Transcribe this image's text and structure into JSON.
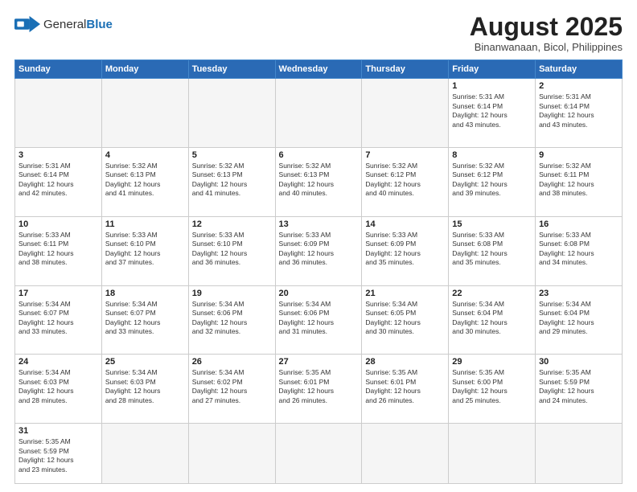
{
  "logo": {
    "text_general": "General",
    "text_blue": "Blue"
  },
  "header": {
    "month": "August 2025",
    "location": "Binanwanaan, Bicol, Philippines"
  },
  "days_of_week": [
    "Sunday",
    "Monday",
    "Tuesday",
    "Wednesday",
    "Thursday",
    "Friday",
    "Saturday"
  ],
  "weeks": [
    [
      {
        "day": "",
        "info": ""
      },
      {
        "day": "",
        "info": ""
      },
      {
        "day": "",
        "info": ""
      },
      {
        "day": "",
        "info": ""
      },
      {
        "day": "",
        "info": ""
      },
      {
        "day": "1",
        "info": "Sunrise: 5:31 AM\nSunset: 6:14 PM\nDaylight: 12 hours\nand 43 minutes."
      },
      {
        "day": "2",
        "info": "Sunrise: 5:31 AM\nSunset: 6:14 PM\nDaylight: 12 hours\nand 43 minutes."
      }
    ],
    [
      {
        "day": "3",
        "info": "Sunrise: 5:31 AM\nSunset: 6:14 PM\nDaylight: 12 hours\nand 42 minutes."
      },
      {
        "day": "4",
        "info": "Sunrise: 5:32 AM\nSunset: 6:13 PM\nDaylight: 12 hours\nand 41 minutes."
      },
      {
        "day": "5",
        "info": "Sunrise: 5:32 AM\nSunset: 6:13 PM\nDaylight: 12 hours\nand 41 minutes."
      },
      {
        "day": "6",
        "info": "Sunrise: 5:32 AM\nSunset: 6:13 PM\nDaylight: 12 hours\nand 40 minutes."
      },
      {
        "day": "7",
        "info": "Sunrise: 5:32 AM\nSunset: 6:12 PM\nDaylight: 12 hours\nand 40 minutes."
      },
      {
        "day": "8",
        "info": "Sunrise: 5:32 AM\nSunset: 6:12 PM\nDaylight: 12 hours\nand 39 minutes."
      },
      {
        "day": "9",
        "info": "Sunrise: 5:32 AM\nSunset: 6:11 PM\nDaylight: 12 hours\nand 38 minutes."
      }
    ],
    [
      {
        "day": "10",
        "info": "Sunrise: 5:33 AM\nSunset: 6:11 PM\nDaylight: 12 hours\nand 38 minutes."
      },
      {
        "day": "11",
        "info": "Sunrise: 5:33 AM\nSunset: 6:10 PM\nDaylight: 12 hours\nand 37 minutes."
      },
      {
        "day": "12",
        "info": "Sunrise: 5:33 AM\nSunset: 6:10 PM\nDaylight: 12 hours\nand 36 minutes."
      },
      {
        "day": "13",
        "info": "Sunrise: 5:33 AM\nSunset: 6:09 PM\nDaylight: 12 hours\nand 36 minutes."
      },
      {
        "day": "14",
        "info": "Sunrise: 5:33 AM\nSunset: 6:09 PM\nDaylight: 12 hours\nand 35 minutes."
      },
      {
        "day": "15",
        "info": "Sunrise: 5:33 AM\nSunset: 6:08 PM\nDaylight: 12 hours\nand 35 minutes."
      },
      {
        "day": "16",
        "info": "Sunrise: 5:33 AM\nSunset: 6:08 PM\nDaylight: 12 hours\nand 34 minutes."
      }
    ],
    [
      {
        "day": "17",
        "info": "Sunrise: 5:34 AM\nSunset: 6:07 PM\nDaylight: 12 hours\nand 33 minutes."
      },
      {
        "day": "18",
        "info": "Sunrise: 5:34 AM\nSunset: 6:07 PM\nDaylight: 12 hours\nand 33 minutes."
      },
      {
        "day": "19",
        "info": "Sunrise: 5:34 AM\nSunset: 6:06 PM\nDaylight: 12 hours\nand 32 minutes."
      },
      {
        "day": "20",
        "info": "Sunrise: 5:34 AM\nSunset: 6:06 PM\nDaylight: 12 hours\nand 31 minutes."
      },
      {
        "day": "21",
        "info": "Sunrise: 5:34 AM\nSunset: 6:05 PM\nDaylight: 12 hours\nand 30 minutes."
      },
      {
        "day": "22",
        "info": "Sunrise: 5:34 AM\nSunset: 6:04 PM\nDaylight: 12 hours\nand 30 minutes."
      },
      {
        "day": "23",
        "info": "Sunrise: 5:34 AM\nSunset: 6:04 PM\nDaylight: 12 hours\nand 29 minutes."
      }
    ],
    [
      {
        "day": "24",
        "info": "Sunrise: 5:34 AM\nSunset: 6:03 PM\nDaylight: 12 hours\nand 28 minutes."
      },
      {
        "day": "25",
        "info": "Sunrise: 5:34 AM\nSunset: 6:03 PM\nDaylight: 12 hours\nand 28 minutes."
      },
      {
        "day": "26",
        "info": "Sunrise: 5:34 AM\nSunset: 6:02 PM\nDaylight: 12 hours\nand 27 minutes."
      },
      {
        "day": "27",
        "info": "Sunrise: 5:35 AM\nSunset: 6:01 PM\nDaylight: 12 hours\nand 26 minutes."
      },
      {
        "day": "28",
        "info": "Sunrise: 5:35 AM\nSunset: 6:01 PM\nDaylight: 12 hours\nand 26 minutes."
      },
      {
        "day": "29",
        "info": "Sunrise: 5:35 AM\nSunset: 6:00 PM\nDaylight: 12 hours\nand 25 minutes."
      },
      {
        "day": "30",
        "info": "Sunrise: 5:35 AM\nSunset: 5:59 PM\nDaylight: 12 hours\nand 24 minutes."
      }
    ],
    [
      {
        "day": "31",
        "info": "Sunrise: 5:35 AM\nSunset: 5:59 PM\nDaylight: 12 hours\nand 23 minutes."
      },
      {
        "day": "",
        "info": ""
      },
      {
        "day": "",
        "info": ""
      },
      {
        "day": "",
        "info": ""
      },
      {
        "day": "",
        "info": ""
      },
      {
        "day": "",
        "info": ""
      },
      {
        "day": "",
        "info": ""
      }
    ]
  ],
  "empty_days_week1": [
    0,
    1,
    2,
    3,
    4
  ],
  "empty_days_week6": [
    1,
    2,
    3,
    4,
    5,
    6
  ]
}
